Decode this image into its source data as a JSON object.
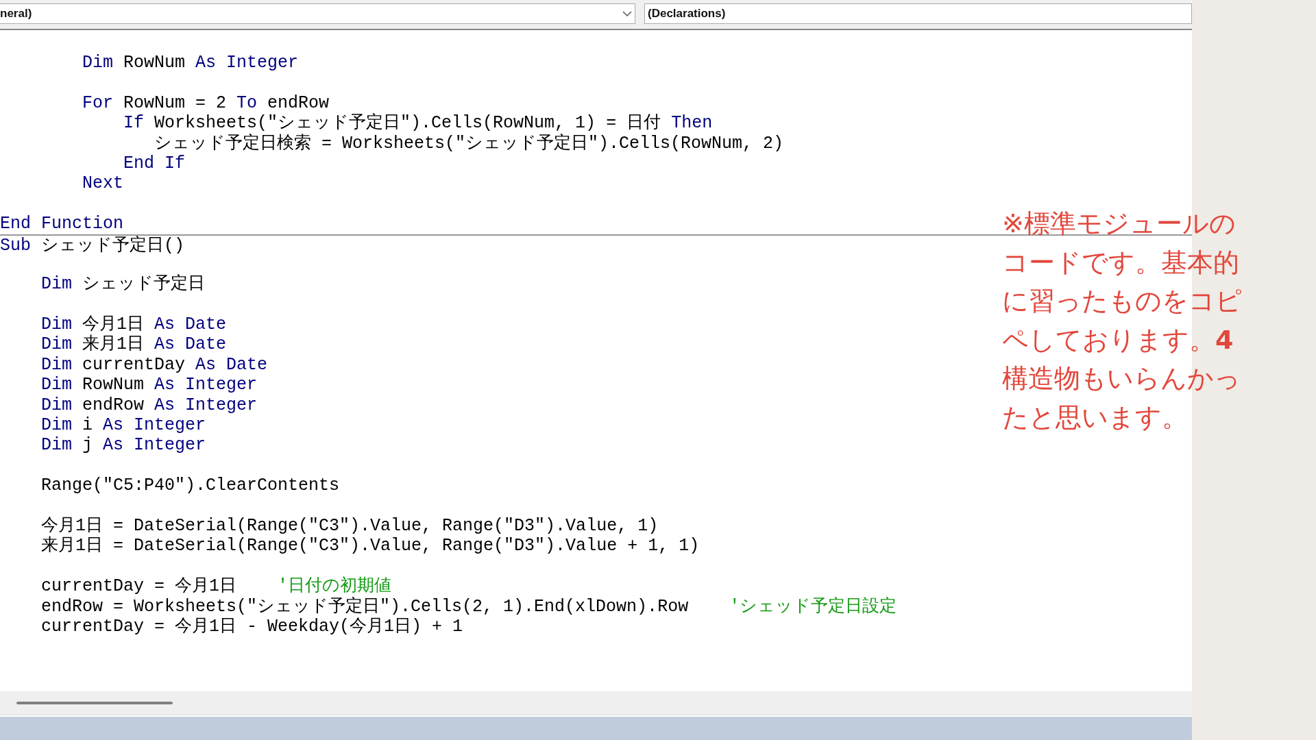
{
  "header": {
    "object_box": "neral)",
    "procedure_box": "(Declarations)"
  },
  "code_lines": [
    {
      "kind": "code",
      "separator_above": false,
      "tokens": [
        {
          "text": "        Dim",
          "kind": "keyword"
        },
        {
          "text": " RowNum ",
          "kind": "plain"
        },
        {
          "text": "As Integer",
          "kind": "keyword"
        }
      ]
    },
    {
      "kind": "blank",
      "separator_above": false
    },
    {
      "kind": "code",
      "separator_above": false,
      "tokens": [
        {
          "text": "        For",
          "kind": "keyword"
        },
        {
          "text": " RowNum = 2 ",
          "kind": "plain"
        },
        {
          "text": "To",
          "kind": "keyword"
        },
        {
          "text": " endRow",
          "kind": "plain"
        }
      ]
    },
    {
      "kind": "code",
      "separator_above": false,
      "tokens": [
        {
          "text": "            If",
          "kind": "keyword"
        },
        {
          "text": " Worksheets(\"シェッド予定日\").Cells(RowNum, 1) = 日付 ",
          "kind": "plain"
        },
        {
          "text": "Then",
          "kind": "keyword"
        }
      ]
    },
    {
      "kind": "code",
      "separator_above": false,
      "tokens": [
        {
          "text": "               シェッド予定日検索 = Worksheets(\"シェッド予定日\").Cells(RowNum, 2)",
          "kind": "plain"
        }
      ]
    },
    {
      "kind": "code",
      "separator_above": false,
      "tokens": [
        {
          "text": "            End If",
          "kind": "keyword"
        }
      ]
    },
    {
      "kind": "code",
      "separator_above": false,
      "tokens": [
        {
          "text": "        Next",
          "kind": "keyword"
        }
      ]
    },
    {
      "kind": "blank",
      "separator_above": false
    },
    {
      "kind": "code",
      "separator_above": false,
      "tokens": [
        {
          "text": "End Function",
          "kind": "keyword"
        }
      ]
    },
    {
      "kind": "code",
      "separator_above": true,
      "tokens": [
        {
          "text": "Sub",
          "kind": "keyword"
        },
        {
          "text": " シェッド予定日()",
          "kind": "plain"
        }
      ]
    },
    {
      "kind": "blank",
      "separator_above": false
    },
    {
      "kind": "code",
      "separator_above": false,
      "tokens": [
        {
          "text": "    Dim",
          "kind": "keyword"
        },
        {
          "text": " シェッド予定日",
          "kind": "plain"
        }
      ]
    },
    {
      "kind": "blank",
      "separator_above": false
    },
    {
      "kind": "code",
      "separator_above": false,
      "tokens": [
        {
          "text": "    Dim",
          "kind": "keyword"
        },
        {
          "text": " 今月1日 ",
          "kind": "plain"
        },
        {
          "text": "As Date",
          "kind": "keyword"
        }
      ]
    },
    {
      "kind": "code",
      "separator_above": false,
      "tokens": [
        {
          "text": "    Dim",
          "kind": "keyword"
        },
        {
          "text": " 来月1日 ",
          "kind": "plain"
        },
        {
          "text": "As Date",
          "kind": "keyword"
        }
      ]
    },
    {
      "kind": "code",
      "separator_above": false,
      "tokens": [
        {
          "text": "    Dim",
          "kind": "keyword"
        },
        {
          "text": " currentDay ",
          "kind": "plain"
        },
        {
          "text": "As Date",
          "kind": "keyword"
        }
      ]
    },
    {
      "kind": "code",
      "separator_above": false,
      "tokens": [
        {
          "text": "    Dim",
          "kind": "keyword"
        },
        {
          "text": " RowNum ",
          "kind": "plain"
        },
        {
          "text": "As Integer",
          "kind": "keyword"
        }
      ]
    },
    {
      "kind": "code",
      "separator_above": false,
      "tokens": [
        {
          "text": "    Dim",
          "kind": "keyword"
        },
        {
          "text": " endRow ",
          "kind": "plain"
        },
        {
          "text": "As Integer",
          "kind": "keyword"
        }
      ]
    },
    {
      "kind": "code",
      "separator_above": false,
      "tokens": [
        {
          "text": "    Dim",
          "kind": "keyword"
        },
        {
          "text": " i ",
          "kind": "plain"
        },
        {
          "text": "As Integer",
          "kind": "keyword"
        }
      ]
    },
    {
      "kind": "code",
      "separator_above": false,
      "tokens": [
        {
          "text": "    Dim",
          "kind": "keyword"
        },
        {
          "text": " j ",
          "kind": "plain"
        },
        {
          "text": "As Integer",
          "kind": "keyword"
        }
      ]
    },
    {
      "kind": "blank",
      "separator_above": false
    },
    {
      "kind": "code",
      "separator_above": false,
      "tokens": [
        {
          "text": "    Range(\"C5:P40\").ClearContents",
          "kind": "plain"
        }
      ]
    },
    {
      "kind": "blank",
      "separator_above": false
    },
    {
      "kind": "code",
      "separator_above": false,
      "tokens": [
        {
          "text": "    今月1日 = DateSerial(Range(\"C3\").Value, Range(\"D3\").Value, 1)",
          "kind": "plain"
        }
      ]
    },
    {
      "kind": "code",
      "separator_above": false,
      "tokens": [
        {
          "text": "    来月1日 = DateSerial(Range(\"C3\").Value, Range(\"D3\").Value + 1, 1)",
          "kind": "plain"
        }
      ]
    },
    {
      "kind": "blank",
      "separator_above": false
    },
    {
      "kind": "code",
      "separator_above": false,
      "tokens": [
        {
          "text": "    currentDay = 今月1日    ",
          "kind": "plain"
        },
        {
          "text": "'日付の初期値",
          "kind": "comment"
        }
      ]
    },
    {
      "kind": "code",
      "separator_above": false,
      "tokens": [
        {
          "text": "    endRow = Worksheets(\"シェッド予定日\").Cells(2, 1).End(xlDown).Row    ",
          "kind": "plain"
        },
        {
          "text": "'シェッド予定日設定",
          "kind": "comment"
        }
      ]
    },
    {
      "kind": "code",
      "separator_above": false,
      "tokens": [
        {
          "text": "    currentDay = 今月1日 - Weekday(今月1日) + 1",
          "kind": "plain"
        }
      ]
    }
  ],
  "note": "※標準モジュールのコードです。基本的に習ったものをコピペしております。**4**構造物もいらんかったと思います。"
}
